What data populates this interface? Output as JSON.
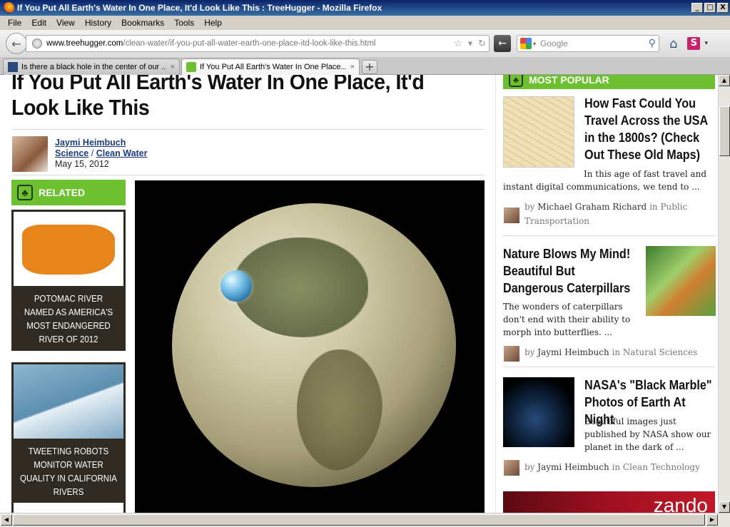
{
  "window": {
    "title": "If You Put All Earth's Water In One Place, It'd Look Like This : TreeHugger - Mozilla Firefox",
    "minimize": "_",
    "maximize": "□",
    "close": "X"
  },
  "menu": [
    "File",
    "Edit",
    "View",
    "History",
    "Bookmarks",
    "Tools",
    "Help"
  ],
  "nav": {
    "url_host": "www.treehugger.com",
    "url_path": "/clean-water/if-you-put-all-water-earth-one-place-itd-look-like-this.html",
    "search_placeholder": "Google"
  },
  "tabs": [
    {
      "label": "Is there a black hole in the center of our ...",
      "active": false
    },
    {
      "label": "If You Put All Earth's Water In One Place...",
      "active": true
    }
  ],
  "article": {
    "headline": "If You Put All Earth's Water In One Place, It'd Look Like This",
    "author": "Jaymi Heimbuch",
    "category": "Science",
    "category_sep": "/",
    "subcategory": "Clean Water",
    "date": "May 15, 2012"
  },
  "related": {
    "heading": "RELATED",
    "items": [
      {
        "caption": "POTOMAC RIVER NAMED AS AMERICA'S MOST ENDANGERED RIVER OF 2012"
      },
      {
        "caption": "TWEETING ROBOTS MONITOR WATER QUALITY IN CALIFORNIA RIVERS"
      }
    ]
  },
  "popular": {
    "heading": "MOST POPULAR",
    "items": [
      {
        "title": "How Fast Could You Travel Across the USA in the 1800s? (Check Out These Old Maps)",
        "desc": "In this age of fast travel and instant digital communications, we tend to ...",
        "by": "by",
        "author": "Michael Graham Richard",
        "in": "in Public Transportation"
      },
      {
        "title": "Nature Blows My Mind! Beautiful But Dangerous Caterpillars",
        "desc": "The wonders of caterpillars don't end with their ability to morph into butterflies. ...",
        "by": "by",
        "author": "Jaymi Heimbuch",
        "in": "in Natural Sciences"
      },
      {
        "title": "NASA's \"Black Marble\" Photos of Earth At Night",
        "desc": "Beautiful images just published by NASA show our planet in the dark of ...",
        "by": "by",
        "author": "Jaymi Heimbuch",
        "in": "in Clean Technology"
      }
    ]
  },
  "ad": {
    "text": "zando"
  },
  "icons": {
    "back": "←",
    "star": "☆",
    "dropdown": "▾",
    "reload": "↻",
    "search": "⚲",
    "home": "⌂",
    "s_addon": "S",
    "close_tab": "×",
    "new_tab": "+",
    "tree": "♣",
    "up": "▲",
    "down": "▼",
    "left": "◀",
    "right": "▶"
  }
}
